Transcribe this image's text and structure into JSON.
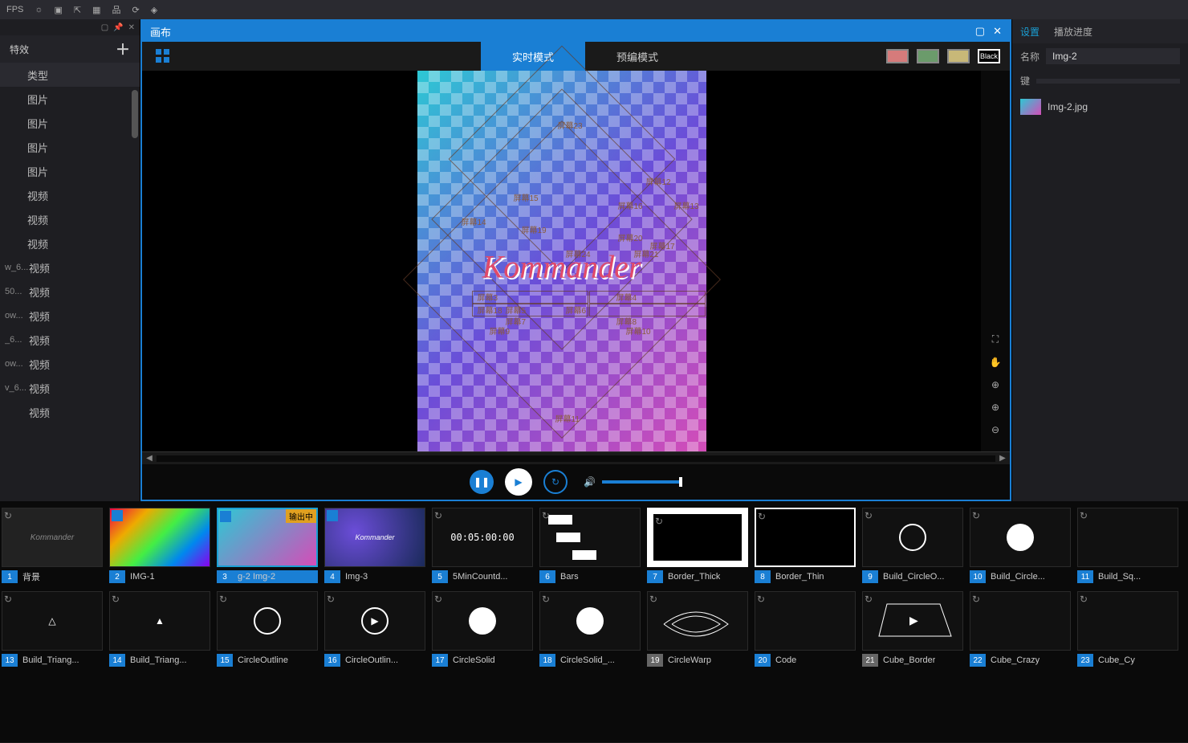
{
  "topbar": {
    "fps": "FPS"
  },
  "leftPanel": {
    "title": "特效",
    "header": "类型",
    "items": [
      "图片",
      "图片",
      "图片",
      "图片",
      "视频",
      "视频",
      "视频"
    ],
    "subItems": [
      {
        "prefix": "w_6...",
        "label": "视频"
      },
      {
        "prefix": "50...",
        "label": "视频"
      },
      {
        "prefix": "ow...",
        "label": "视频"
      },
      {
        "prefix": "_6...",
        "label": "视频"
      },
      {
        "prefix": "ow...",
        "label": "视频"
      },
      {
        "prefix": "v_6...",
        "label": "视频"
      },
      {
        "prefix": "",
        "label": "视频"
      }
    ]
  },
  "canvas": {
    "title": "画布",
    "tabLive": "实时模式",
    "tabPre": "预编模式",
    "blackLabel": "Black",
    "logoText": "Kommander",
    "screenLabels": [
      "屏幕3",
      "屏幕4",
      "屏幕5",
      "屏幕6",
      "屏幕7",
      "屏幕8",
      "屏幕9",
      "屏幕10",
      "屏幕11",
      "屏幕12",
      "屏幕13",
      "屏幕14",
      "屏幕15",
      "屏幕16",
      "屏幕17",
      "屏幕18",
      "屏幕19",
      "屏幕20",
      "屏幕21",
      "屏幕23",
      "屏幕24"
    ]
  },
  "rightPanel": {
    "tabSettings": "设置",
    "tabProgress": "播放进度",
    "nameLabel": "名称",
    "nameValue": "Img-2",
    "pathLabel": "键",
    "fileName": "Img-2.jpg"
  },
  "thumbs": {
    "row1": [
      {
        "num": "1",
        "label": "背景",
        "kind": "art1",
        "badge": "",
        "sel": false,
        "gray": false
      },
      {
        "num": "2",
        "label": "IMG-1",
        "kind": "rainbow",
        "badge": "",
        "sel": false,
        "gray": false
      },
      {
        "num": "3",
        "label": "g-2    Img-2",
        "kind": "checker",
        "badge": "输出中",
        "sel": true,
        "gray": false
      },
      {
        "num": "4",
        "label": "Img-3",
        "kind": "bubble",
        "badge": "",
        "sel": false,
        "gray": false
      },
      {
        "num": "5",
        "label": "5MinCountd...",
        "kind": "timer",
        "badge": "",
        "sel": false,
        "gray": false,
        "text": "00:05:00:00"
      },
      {
        "num": "6",
        "label": "Bars",
        "kind": "bars",
        "badge": "",
        "sel": false,
        "gray": false
      },
      {
        "num": "7",
        "label": "Border_Thick",
        "kind": "border-thick",
        "badge": "",
        "sel": false,
        "gray": false
      },
      {
        "num": "8",
        "label": "Border_Thin",
        "kind": "border-thin",
        "badge": "",
        "sel": false,
        "gray": false
      },
      {
        "num": "9",
        "label": "Build_CircleO...",
        "kind": "cline",
        "badge": "",
        "sel": false,
        "gray": false
      },
      {
        "num": "10",
        "label": "Build_Circle...",
        "kind": "csolid",
        "badge": "",
        "sel": false,
        "gray": false
      },
      {
        "num": "11",
        "label": "Build_Sq...",
        "kind": "black",
        "badge": "",
        "sel": false,
        "gray": false
      }
    ],
    "row2": [
      {
        "num": "13",
        "label": "Build_Triang...",
        "kind": "tri-line",
        "badge": "",
        "sel": false,
        "gray": false
      },
      {
        "num": "14",
        "label": "Build_Triang...",
        "kind": "tri-solid",
        "badge": "",
        "sel": false,
        "gray": false
      },
      {
        "num": "15",
        "label": "CircleOutline",
        "kind": "cline",
        "badge": "",
        "sel": false,
        "gray": false
      },
      {
        "num": "16",
        "label": "CircleOutlin...",
        "kind": "cline-play",
        "badge": "",
        "sel": false,
        "gray": false
      },
      {
        "num": "17",
        "label": "CircleSolid",
        "kind": "csolid",
        "badge": "",
        "sel": false,
        "gray": false
      },
      {
        "num": "18",
        "label": "CircleSolid_...",
        "kind": "csolid",
        "badge": "",
        "sel": false,
        "gray": false
      },
      {
        "num": "19",
        "label": "CircleWarp",
        "kind": "warp",
        "badge": "",
        "sel": false,
        "gray": true
      },
      {
        "num": "20",
        "label": "Code",
        "kind": "black",
        "badge": "",
        "sel": false,
        "gray": false
      },
      {
        "num": "21",
        "label": "Cube_Border",
        "kind": "cube",
        "badge": "",
        "sel": false,
        "gray": true
      },
      {
        "num": "22",
        "label": "Cube_Crazy",
        "kind": "black",
        "badge": "",
        "sel": false,
        "gray": false
      },
      {
        "num": "23",
        "label": "Cube_Cy",
        "kind": "black",
        "badge": "",
        "sel": false,
        "gray": false
      }
    ]
  }
}
